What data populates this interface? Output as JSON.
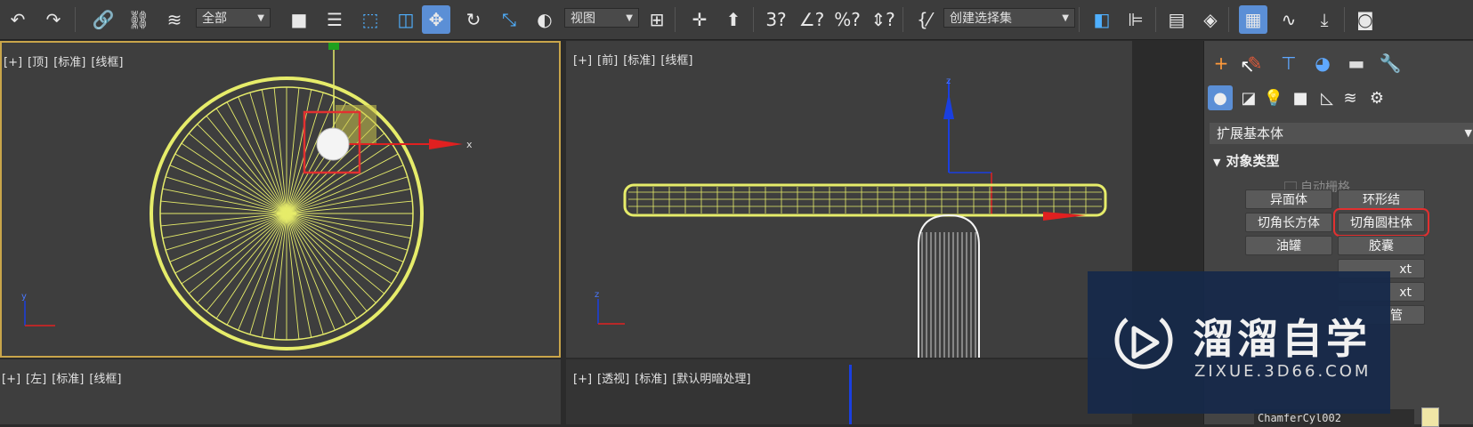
{
  "toolbar": {
    "selection_filter": "全部",
    "reference_coord": "视图",
    "named_selection_set": "创建选择集"
  },
  "viewports": {
    "top": {
      "plus": "[+]",
      "view": "[顶]",
      "shading_mode": "[标准]",
      "display": "[线框]"
    },
    "front": {
      "plus": "[+]",
      "view": "[前]",
      "shading_mode": "[标准]",
      "display": "[线框]"
    },
    "left": {
      "plus": "[+]",
      "view": "[左]",
      "shading_mode": "[标准]",
      "display": "[线框]"
    },
    "perspective": {
      "plus": "[+]",
      "view": "[透视]",
      "shading_mode": "[标准]",
      "display": "[默认明暗处理]"
    },
    "axis_labels": {
      "x": "x",
      "y": "y",
      "z": "z"
    }
  },
  "command_panel": {
    "category": "扩展基本体",
    "rollout_title": "对象类型",
    "autogrid_label": "自动栅格",
    "buttons": [
      {
        "label": "异面体"
      },
      {
        "label": "环形结"
      },
      {
        "label": "切角长方体"
      },
      {
        "label": "切角圆柱体",
        "highlighted": true
      },
      {
        "label": "油罐"
      },
      {
        "label": "胶囊"
      },
      {
        "label": "xt"
      },
      {
        "label": "xt"
      },
      {
        "label": "管"
      }
    ],
    "object_name": "ChamferCyl002"
  },
  "watermark": {
    "title": "溜溜自学",
    "url": "ZIXUE.3D66.COM"
  },
  "colors": {
    "wireframe": "#e6ec6a",
    "highlight_box": "#e23030",
    "gizmo_x": "#e02020",
    "gizmo_y": "#20c020",
    "gizmo_z": "#1a3fe0",
    "active_button": "#5b8fd6",
    "swatch": "#f0e6a6"
  }
}
